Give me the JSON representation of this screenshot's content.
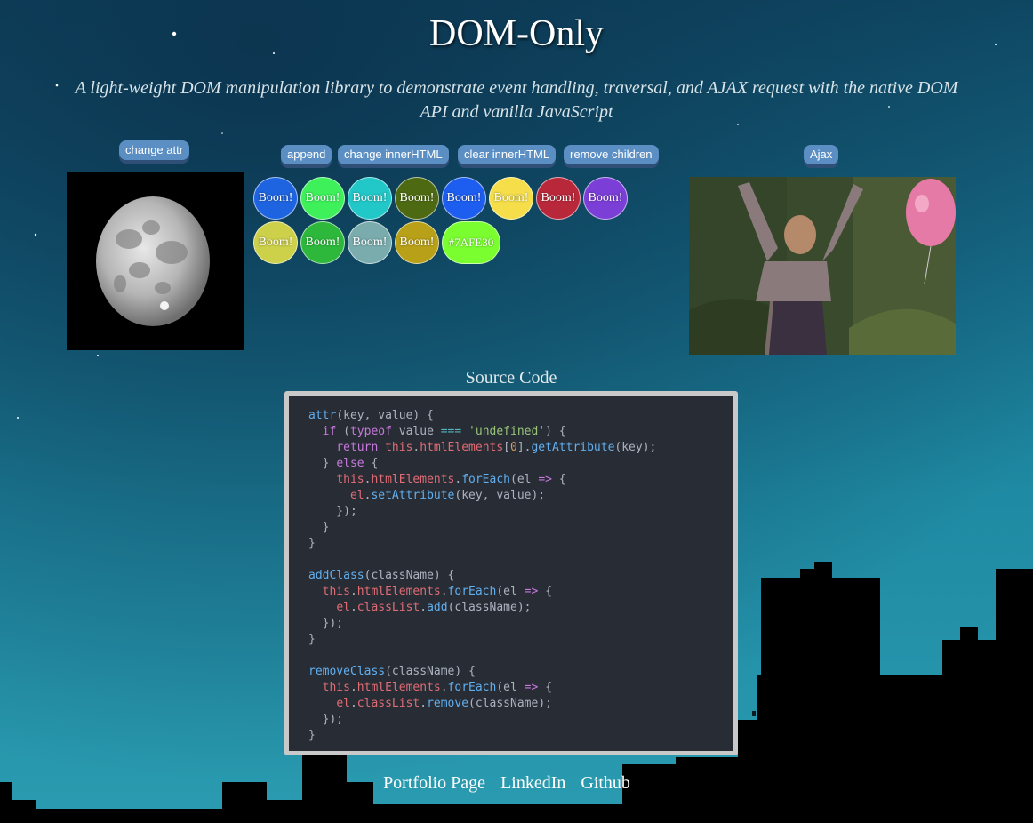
{
  "header": {
    "title": "DOM-Only",
    "subtitle": "A light-weight DOM manipulation library to demonstrate event handling, traversal, and AJAX request with the native DOM API and vanilla JavaScript"
  },
  "buttons": {
    "change_attr": "change attr",
    "append": "append",
    "change_inner_html": "change innerHTML",
    "clear_inner_html": "clear innerHTML",
    "remove_children": "remove children",
    "ajax": "Ajax"
  },
  "booms": [
    {
      "label": "Boom!",
      "color": "#1e64e0"
    },
    {
      "label": "Boom!",
      "color": "#3ef05a"
    },
    {
      "label": "Boom!",
      "color": "#22c7c7"
    },
    {
      "label": "Boom!",
      "color": "#4d6a12"
    },
    {
      "label": "Boom!",
      "color": "#1d5ef0"
    },
    {
      "label": "Boom!",
      "color": "#f5de4a"
    },
    {
      "label": "Boom!",
      "color": "#b8283a"
    },
    {
      "label": "Boom!",
      "color": "#7b3ed6"
    },
    {
      "label": "Boom!",
      "color": "#cdd049"
    },
    {
      "label": "Boom!",
      "color": "#2db83c"
    },
    {
      "label": "Boom!",
      "color": "#7aacae"
    },
    {
      "label": "Boom!",
      "color": "#b8a018"
    },
    {
      "label": "#7AFE30",
      "color": "#7afe30"
    }
  ],
  "source": {
    "label": "Source Code"
  },
  "footer": {
    "links": [
      "Portfolio Page",
      "LinkedIn",
      "Github"
    ]
  },
  "icons": {
    "moon": "moon-image",
    "gif": "celebration-gif"
  }
}
